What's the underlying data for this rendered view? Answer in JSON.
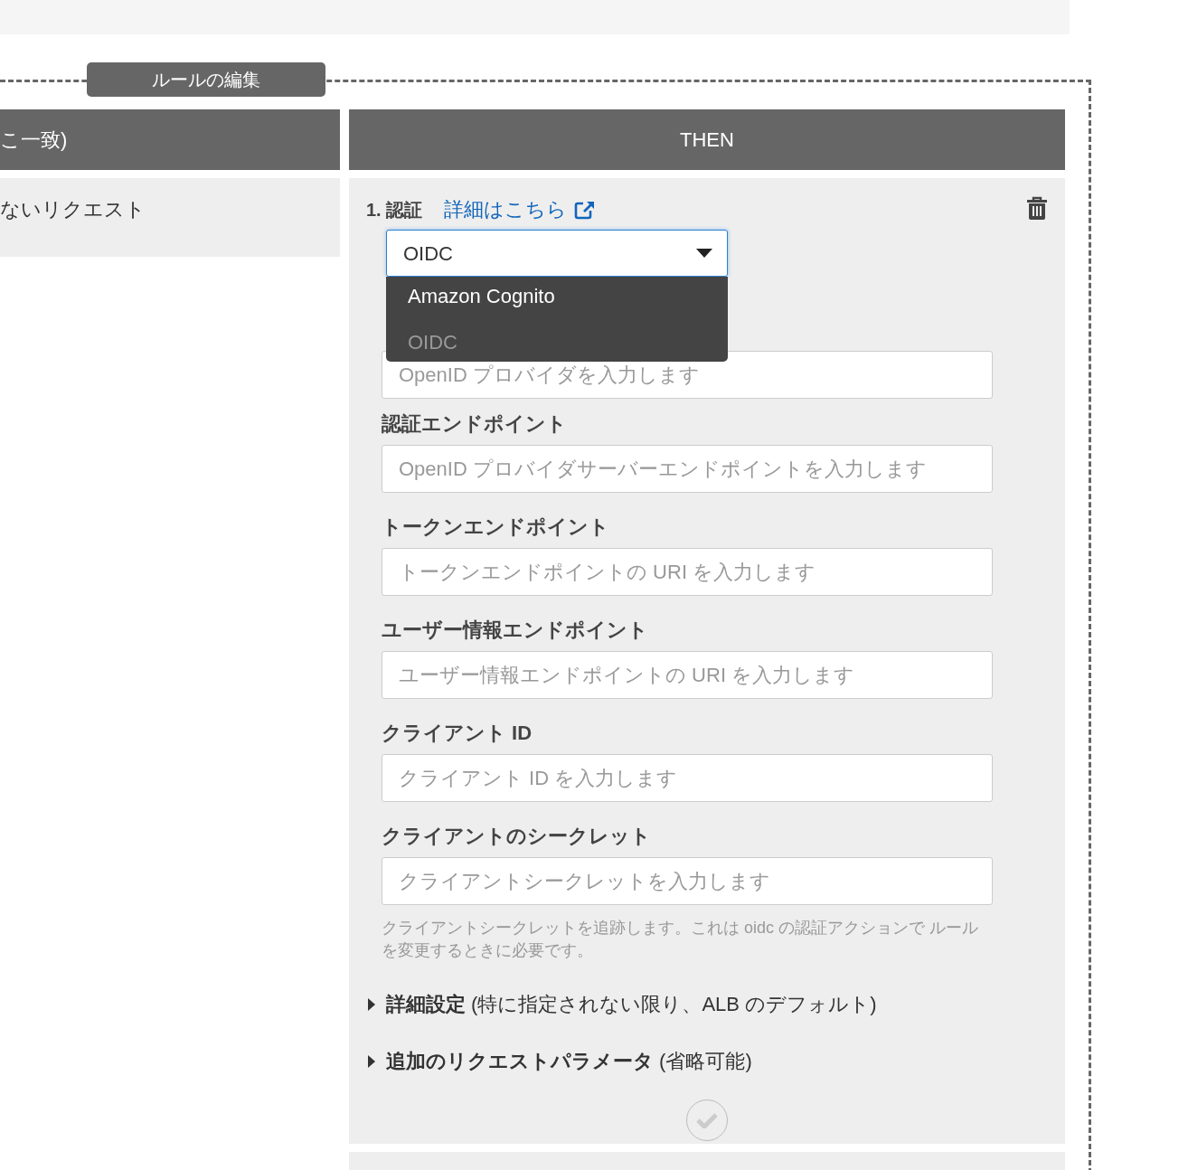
{
  "editor": {
    "title": "ルールの編集"
  },
  "if_column": {
    "header": "こ一致)",
    "condition": "ないリクエスト"
  },
  "then_column": {
    "header": "THEN",
    "action": {
      "number_label": "1. 認証",
      "link": "詳細はこちら",
      "select": {
        "value": "OIDC",
        "expanded": true,
        "options": [
          {
            "label": "Amazon Cognito",
            "selected": false
          },
          {
            "label": "OIDC",
            "selected": true
          }
        ]
      },
      "fields": [
        {
          "placeholder": "OpenID プロバイダを入力します"
        },
        {
          "label": "認証エンドポイント",
          "placeholder": "OpenID プロバイダサーバーエンドポイントを入力します"
        },
        {
          "label": "トークンエンドポイント",
          "placeholder": "トークンエンドポイントの URI を入力します"
        },
        {
          "label": "ユーザー情報エンドポイント",
          "placeholder": "ユーザー情報エンドポイントの URI を入力します"
        },
        {
          "label": "クライアント ID",
          "placeholder": "クライアント ID を入力します"
        },
        {
          "label": "クライアントのシークレット",
          "placeholder": "クライアントシークレットを入力します"
        }
      ],
      "help": "クライアントシークレットを追跡します。これは oidc の認証アクションで ルールを変更するときに必要です。",
      "sections": [
        {
          "title": "詳細設定",
          "note": "(特に指定されない限り、ALB のデフォルト)",
          "expanded": false
        },
        {
          "title": "追加のリクエストパラメータ",
          "note": "(省略可能)",
          "expanded": false
        }
      ]
    }
  }
}
